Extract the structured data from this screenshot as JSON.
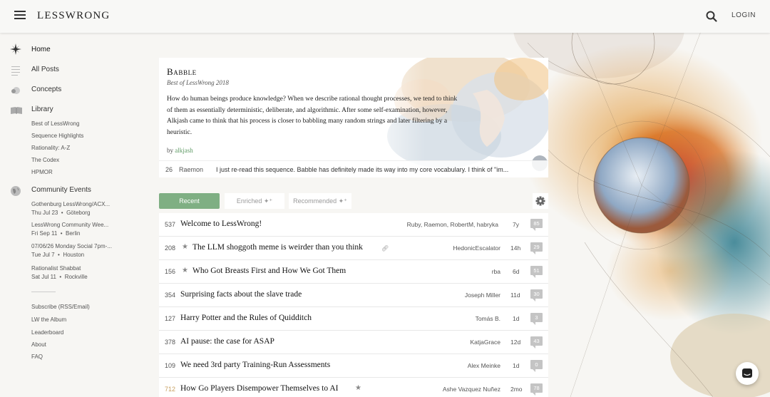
{
  "header": {
    "site_title": "LESSWRONG",
    "login_label": "LOGIN",
    "icons": [
      "menu-icon",
      "search-icon"
    ]
  },
  "sidebar": {
    "main": [
      {
        "label": "Home",
        "icon": "home-compass-icon"
      },
      {
        "label": "All Posts",
        "icon": "all-posts-icon"
      },
      {
        "label": "Concepts",
        "icon": "concepts-icon"
      },
      {
        "label": "Library",
        "icon": "library-book-icon"
      }
    ],
    "library_items": [
      "Best of LessWrong",
      "Sequence Highlights",
      "Rationality: A-Z",
      "The Codex",
      "HPMOR"
    ],
    "community_label": "Community Events",
    "community_icon": "globe-icon",
    "events": [
      {
        "title": "Gothenburg LessWrong/ACX...",
        "date": "Thu Jul 23",
        "location": "Göteborg"
      },
      {
        "title": "LessWrong Community Wee...",
        "date": "Fri Sep 11",
        "location": "Berlin"
      },
      {
        "title": "07/06/26 Monday Social 7pm-...",
        "date": "Tue Jul 7",
        "location": "Houston"
      },
      {
        "title": "Rationalist Shabbat",
        "date": "Sat Jul 11",
        "location": "Rockville"
      }
    ],
    "footer": [
      "Subscribe (RSS/Email)",
      "LW the Album",
      "Leaderboard",
      "About",
      "FAQ"
    ]
  },
  "spotlight": {
    "title": "Babble",
    "subtitle": "Best of LessWrong 2018",
    "description": "How do human beings produce knowledge? When we describe rational thought processes, we tend to think of them as essentially deterministic, deliberate, and algorithmic. After some self-examination, however, Alkjash came to think that his process is closer to babbling many random strings and later filtering by a heuristic.",
    "by_label": "by",
    "author": "alkjash",
    "comment": {
      "karma": "26",
      "user": "Raemon",
      "text": "I just re-read this sequence. Babble has definitely made its way into my core vocabulary. I think of \"im..."
    }
  },
  "tabs": {
    "recent": "Recent",
    "enriched": "Enriched",
    "recommended": "Recommended"
  },
  "posts": [
    {
      "karma": "537",
      "title": "Welcome to LessWrong!",
      "authors": "Ruby, Raemon, RobertM, habryka",
      "age": "7y",
      "comments": "85",
      "starred": false,
      "link": false
    },
    {
      "karma": "208",
      "title": "The LLM shoggoth meme is weirder than you think",
      "authors": "HedonicEscalator",
      "age": "14h",
      "comments": "29",
      "starred": true,
      "link": true
    },
    {
      "karma": "156",
      "title": "Who Got Breasts First and How We Got Them",
      "authors": "rba",
      "age": "6d",
      "comments": "51",
      "starred": true,
      "link": false
    },
    {
      "karma": "354",
      "title": "Surprising facts about the slave trade",
      "authors": "Joseph Miller",
      "age": "11d",
      "comments": "30",
      "starred": false,
      "link": false
    },
    {
      "karma": "127",
      "title": "Harry Potter and the Rules of Quidditch",
      "authors": "Tomás B.",
      "age": "1d",
      "comments": "3",
      "starred": false,
      "link": false
    },
    {
      "karma": "378",
      "title": "AI pause: the case for ASAP",
      "authors": "KatjaGrace",
      "age": "12d",
      "comments": "43",
      "starred": false,
      "link": false
    },
    {
      "karma": "109",
      "title": "We need 3rd party Training-Run Assessments",
      "authors": "Alex Meinke",
      "age": "1d",
      "comments": "0",
      "starred": false,
      "link": false
    },
    {
      "karma": "712",
      "title": "How Go Players Disempower Themselves to AI",
      "authors": "Ashe Vazquez Nuñez",
      "age": "2mo",
      "comments": "78",
      "starred": true,
      "link": false
    }
  ],
  "colors": {
    "accent_green": "#7faf83",
    "author_green": "#5f9b65",
    "comment_badge": "#c4c4c4",
    "background": "#f7f6f3"
  }
}
